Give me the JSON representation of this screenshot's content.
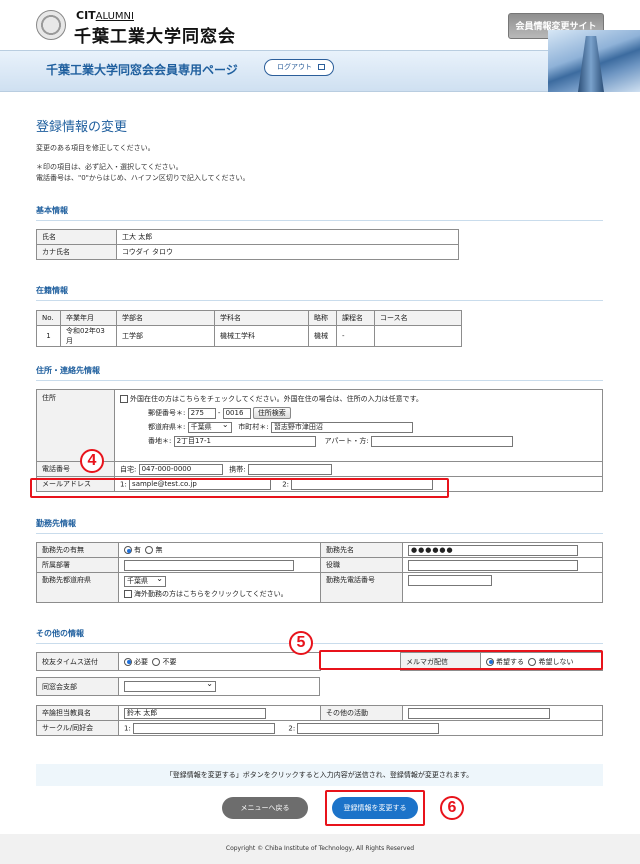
{
  "header": {
    "logo_cit": "CIT",
    "logo_alumni": "ALUMNI",
    "logo_jp": "千葉工業大学同窓会",
    "top_button": "会員情報変更サイト",
    "band_title": "千葉工業大学同窓会会員専用ページ",
    "logout": "ログアウト"
  },
  "page": {
    "title": "登録情報の変更",
    "intro": "変更のある項目を修正してください。",
    "note1": "＊印の項目は、必ず記入・選択してください。",
    "note2": "電話番号は、\"0\"からはじめ、ハイフン区切りで記入してください。"
  },
  "basic": {
    "heading": "基本情報",
    "rows": [
      {
        "label": "氏名",
        "value": "工大 太郎"
      },
      {
        "label": "カナ氏名",
        "value": "コウダイ タロウ"
      }
    ]
  },
  "enroll": {
    "heading": "在籍情報",
    "headers": [
      "No.",
      "卒業年月",
      "学部名",
      "学科名",
      "略称",
      "課程名",
      "コース名"
    ],
    "rows": [
      [
        "1",
        "令和02年03月",
        "工学部",
        "機械工学科",
        "機械",
        "-",
        ""
      ]
    ]
  },
  "address": {
    "heading": "住所・連絡先情報",
    "label": "住所",
    "overseas": "外国在住の方はこちらをチェックしてください。外国在住の場合は、住所の入力は任意です。",
    "postal_label": "郵便番号＊:",
    "postal1": "275",
    "postal2": "0016",
    "search_btn": "住所検索",
    "pref_label": "都道府県＊:",
    "pref": "千葉県",
    "city_label": "市町村＊:",
    "city": "習志野市津田沼",
    "street_label": "番地＊:",
    "street": "2丁目17-1",
    "apt_label": "アパート・方:",
    "phone_label": "電話番号",
    "home_label": "自宅:",
    "home": "047-000-0000",
    "mobile_label": "携帯:",
    "email_label": "メールアドレス",
    "email1_label": "1:",
    "email1": "sample@test.co.jp",
    "email2_label": "2:"
  },
  "work": {
    "heading": "勤務先情報",
    "presence_label": "勤務先の有無",
    "yes": "有",
    "no": "無",
    "company_label": "勤務先名",
    "company": "●●●●●●",
    "dept_label": "所属部署",
    "post_label": "役職",
    "pref_label": "勤務先都道府県",
    "pref": "千葉県",
    "abroad": "海外勤務の方はこちらをクリックしてください。",
    "phone_label": "勤務先電話番号"
  },
  "other": {
    "heading": "その他の情報",
    "times_label": "校友タイムス送付",
    "need": "必要",
    "noneed": "不要",
    "mail_label": "メルマガ配信",
    "want": "希望する",
    "notwant": "希望しない",
    "branch_label": "同窓会支部",
    "teacher_label": "卒論担当教員名",
    "teacher": "鈴木 太郎",
    "activity_label": "その他の活動",
    "circle_label": "サークル/同好会",
    "c1": "1:",
    "c2": "2:"
  },
  "notice": "「登録情報を変更する」ボタンをクリックすると入力内容が送信され、登録情報が変更されます。",
  "buttons": {
    "menu": "メニューへ戻る",
    "save": "登録情報を変更する"
  },
  "markers": {
    "m4": "4",
    "m5": "5",
    "m6": "6"
  },
  "footer": "Copyright © Chiba Institute of Technology, All Rights Reserved"
}
